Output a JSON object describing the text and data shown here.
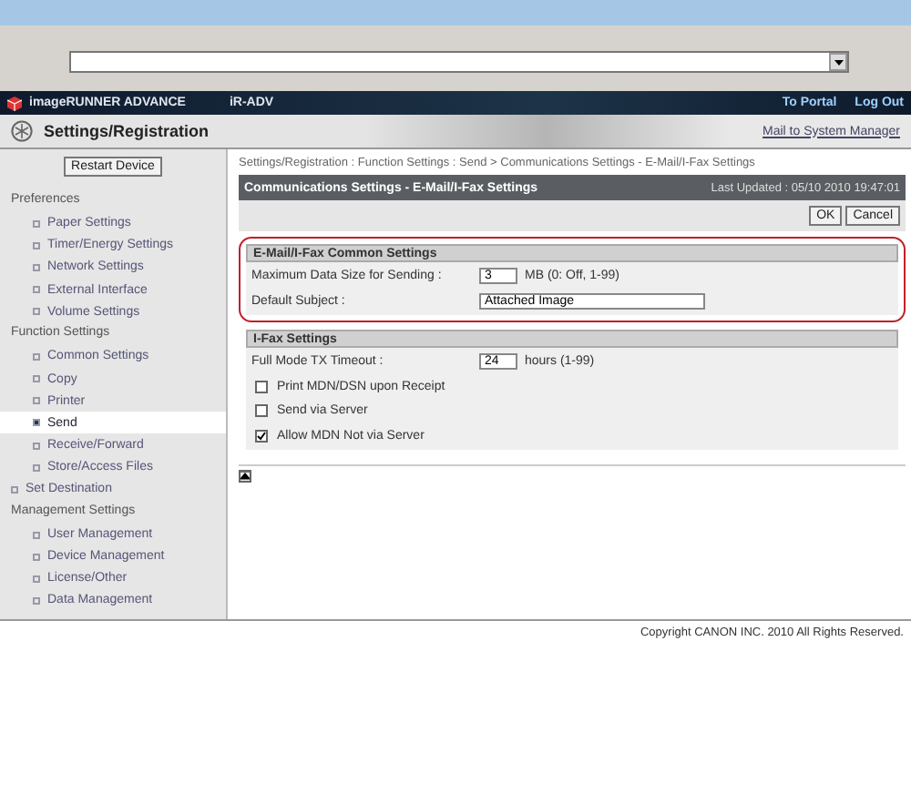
{
  "header": {
    "product": "imageRUNNER ADVANCE",
    "device": "iR-ADV",
    "links": [
      "To Portal",
      "Log Out"
    ]
  },
  "subheader": {
    "title": "Settings/Registration",
    "link": "Mail to System Manager"
  },
  "sidebar": {
    "restart_button": "Restart Device",
    "groups": [
      {
        "label": "Preferences",
        "kind": "heading",
        "items": [
          {
            "label": "Paper Settings",
            "selected": false
          },
          {
            "label": "Timer/Energy Settings",
            "selected": false
          },
          {
            "label": "Network Settings",
            "selected": false
          },
          {
            "label": "External Interface",
            "selected": false
          },
          {
            "label": "Volume Settings",
            "selected": false
          }
        ]
      },
      {
        "label": "Function Settings",
        "kind": "heading",
        "items": [
          {
            "label": "Common Settings",
            "selected": false
          },
          {
            "label": "Copy",
            "selected": false
          },
          {
            "label": "Printer",
            "selected": false
          },
          {
            "label": "Send",
            "selected": true
          },
          {
            "label": "Receive/Forward",
            "selected": false
          },
          {
            "label": "Store/Access Files",
            "selected": false
          }
        ]
      },
      {
        "label": "Set Destination",
        "kind": "link"
      },
      {
        "label": "Management Settings",
        "kind": "heading",
        "items": [
          {
            "label": "User Management",
            "selected": false
          },
          {
            "label": "Device Management",
            "selected": false
          },
          {
            "label": "License/Other",
            "selected": false
          },
          {
            "label": "Data Management",
            "selected": false
          }
        ]
      }
    ]
  },
  "breadcrumb": "Settings/Registration : Function Settings : Send > Communications Settings - E-Mail/I-Fax Settings",
  "page_title": "Communications Settings - E-Mail/I-Fax Settings",
  "last_updated": "Last Updated : 05/10 2010 19:47:01",
  "buttons": [
    "OK",
    "Cancel"
  ],
  "sections": [
    {
      "title": "E-Mail/I-Fax Common Settings",
      "highlighted": true,
      "rows": [
        {
          "kind": "field",
          "label": "Maximum Data Size for Sending :",
          "value": "3",
          "unit": "MB (0: Off, 1-99)",
          "wide": false
        },
        {
          "kind": "field",
          "label": "Default Subject :",
          "value": "Attached Image",
          "wide": true
        }
      ]
    },
    {
      "title": "I-Fax Settings",
      "highlighted": false,
      "rows": [
        {
          "kind": "field",
          "label": "Full Mode TX Timeout :",
          "value": "24",
          "unit": "hours (1-99)",
          "wide": false
        },
        {
          "kind": "checkbox",
          "label": "Print MDN/DSN upon Receipt",
          "checked": false
        },
        {
          "kind": "checkbox",
          "label": "Send via Server",
          "checked": false
        },
        {
          "kind": "checkbox",
          "label": "Allow MDN Not via Server",
          "checked": true
        }
      ]
    }
  ],
  "footer": "Copyright CANON INC. 2010 All Rights Reserved."
}
